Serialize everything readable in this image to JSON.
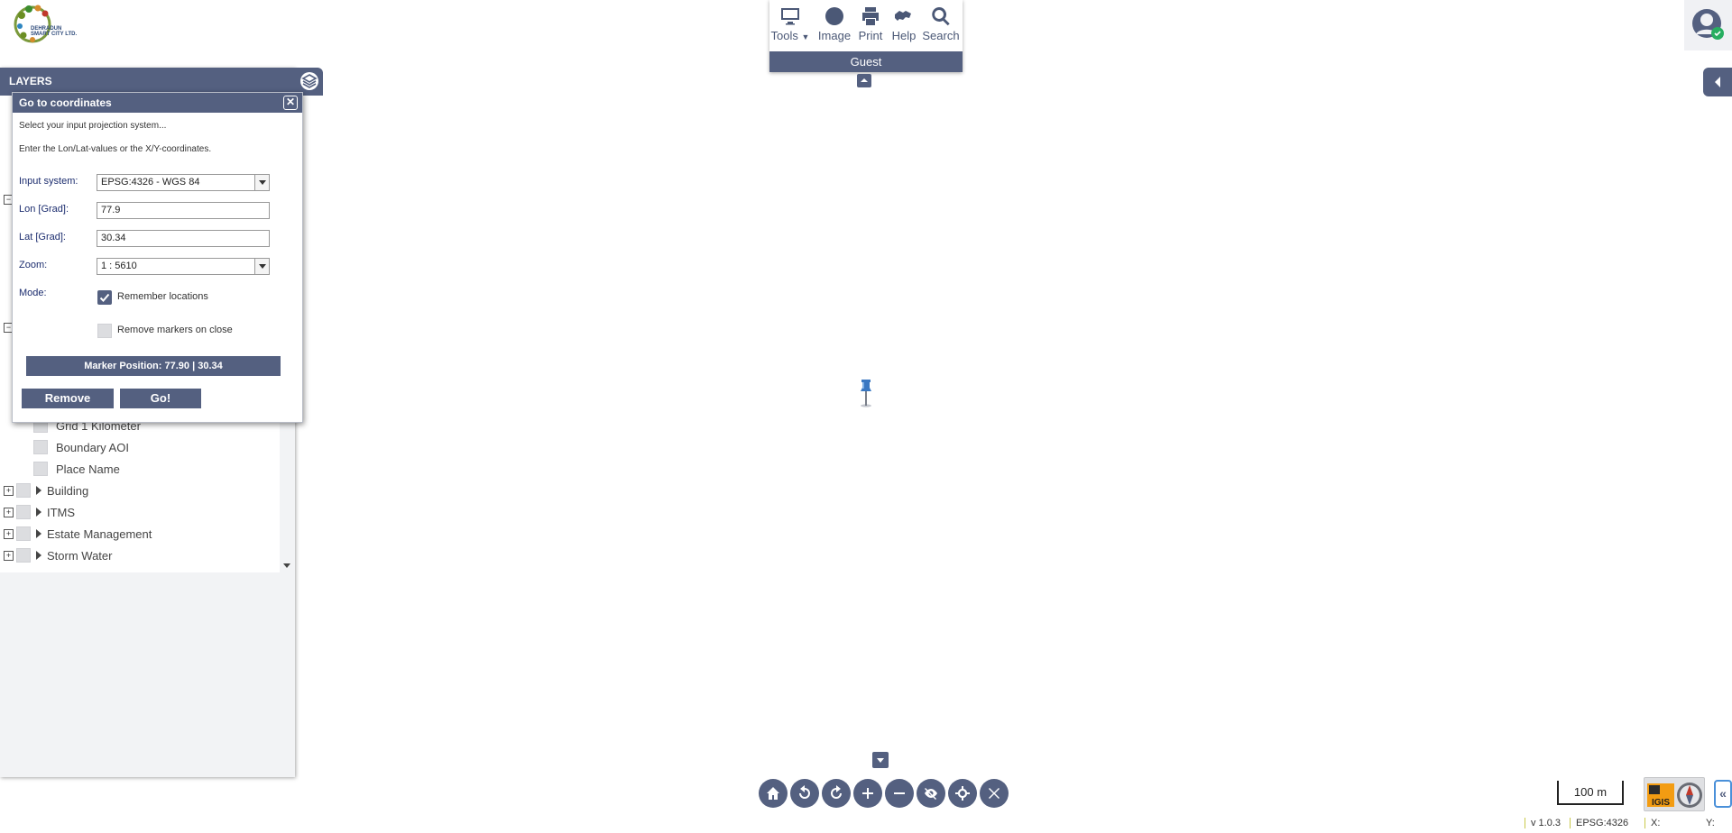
{
  "app": {
    "logo_text_line1": "DEHRADUN",
    "logo_text_line2": "SMART CITY LTD."
  },
  "toolbar": {
    "items": [
      {
        "label": "Tools",
        "icon": "monitor-icon",
        "has_dropdown": true
      },
      {
        "label": "Image",
        "icon": "globe-icon"
      },
      {
        "label": "Print",
        "icon": "printer-icon"
      },
      {
        "label": "Help",
        "icon": "help-hands-icon"
      },
      {
        "label": "Search",
        "icon": "search-icon"
      }
    ],
    "user_label": "Guest"
  },
  "layers_panel": {
    "title": "LAYERS",
    "visible_items": [
      {
        "label": "Grid 1 Kilometer",
        "type": "layer"
      },
      {
        "label": "Boundary AOI",
        "type": "layer"
      },
      {
        "label": "Place Name",
        "type": "layer"
      },
      {
        "label": "Building",
        "type": "group"
      },
      {
        "label": "ITMS",
        "type": "group"
      },
      {
        "label": "Estate Management",
        "type": "group"
      },
      {
        "label": "Storm Water",
        "type": "group"
      }
    ]
  },
  "goto_dialog": {
    "title": "Go to coordinates",
    "hint1": "Select your input projection system...",
    "hint2": "Enter the Lon/Lat-values or the X/Y-coordinates.",
    "input_system_label": "Input system:",
    "input_system_value": "EPSG:4326 - WGS 84",
    "lon_label": "Lon [Grad]:",
    "lon_value": "77.9",
    "lat_label": "Lat [Grad]:",
    "lat_value": "30.34",
    "zoom_label": "Zoom:",
    "zoom_value": "1 : 5610",
    "mode_label": "Mode:",
    "remember_label": "Remember locations",
    "remember_checked": true,
    "remove_on_close_label": "Remove markers on close",
    "remove_on_close_checked": false,
    "marker_position": "Marker Position: 77.90 | 30.34",
    "remove_markers_button": "Remove markers",
    "go_button": "Go!"
  },
  "map": {
    "scale_label": "100 m"
  },
  "nav_buttons": [
    "home-icon",
    "undo-icon",
    "redo-icon",
    "zoom-in-icon",
    "zoom-out-icon",
    "hide-icon",
    "locate-icon",
    "clear-icon"
  ],
  "status_bar": {
    "version": "v 1.0.3",
    "projection": "EPSG:4326",
    "x_label": "X:",
    "y_label": "Y:"
  },
  "colors": {
    "accent": "#546080",
    "panel_bg": "#f2f3f5"
  }
}
